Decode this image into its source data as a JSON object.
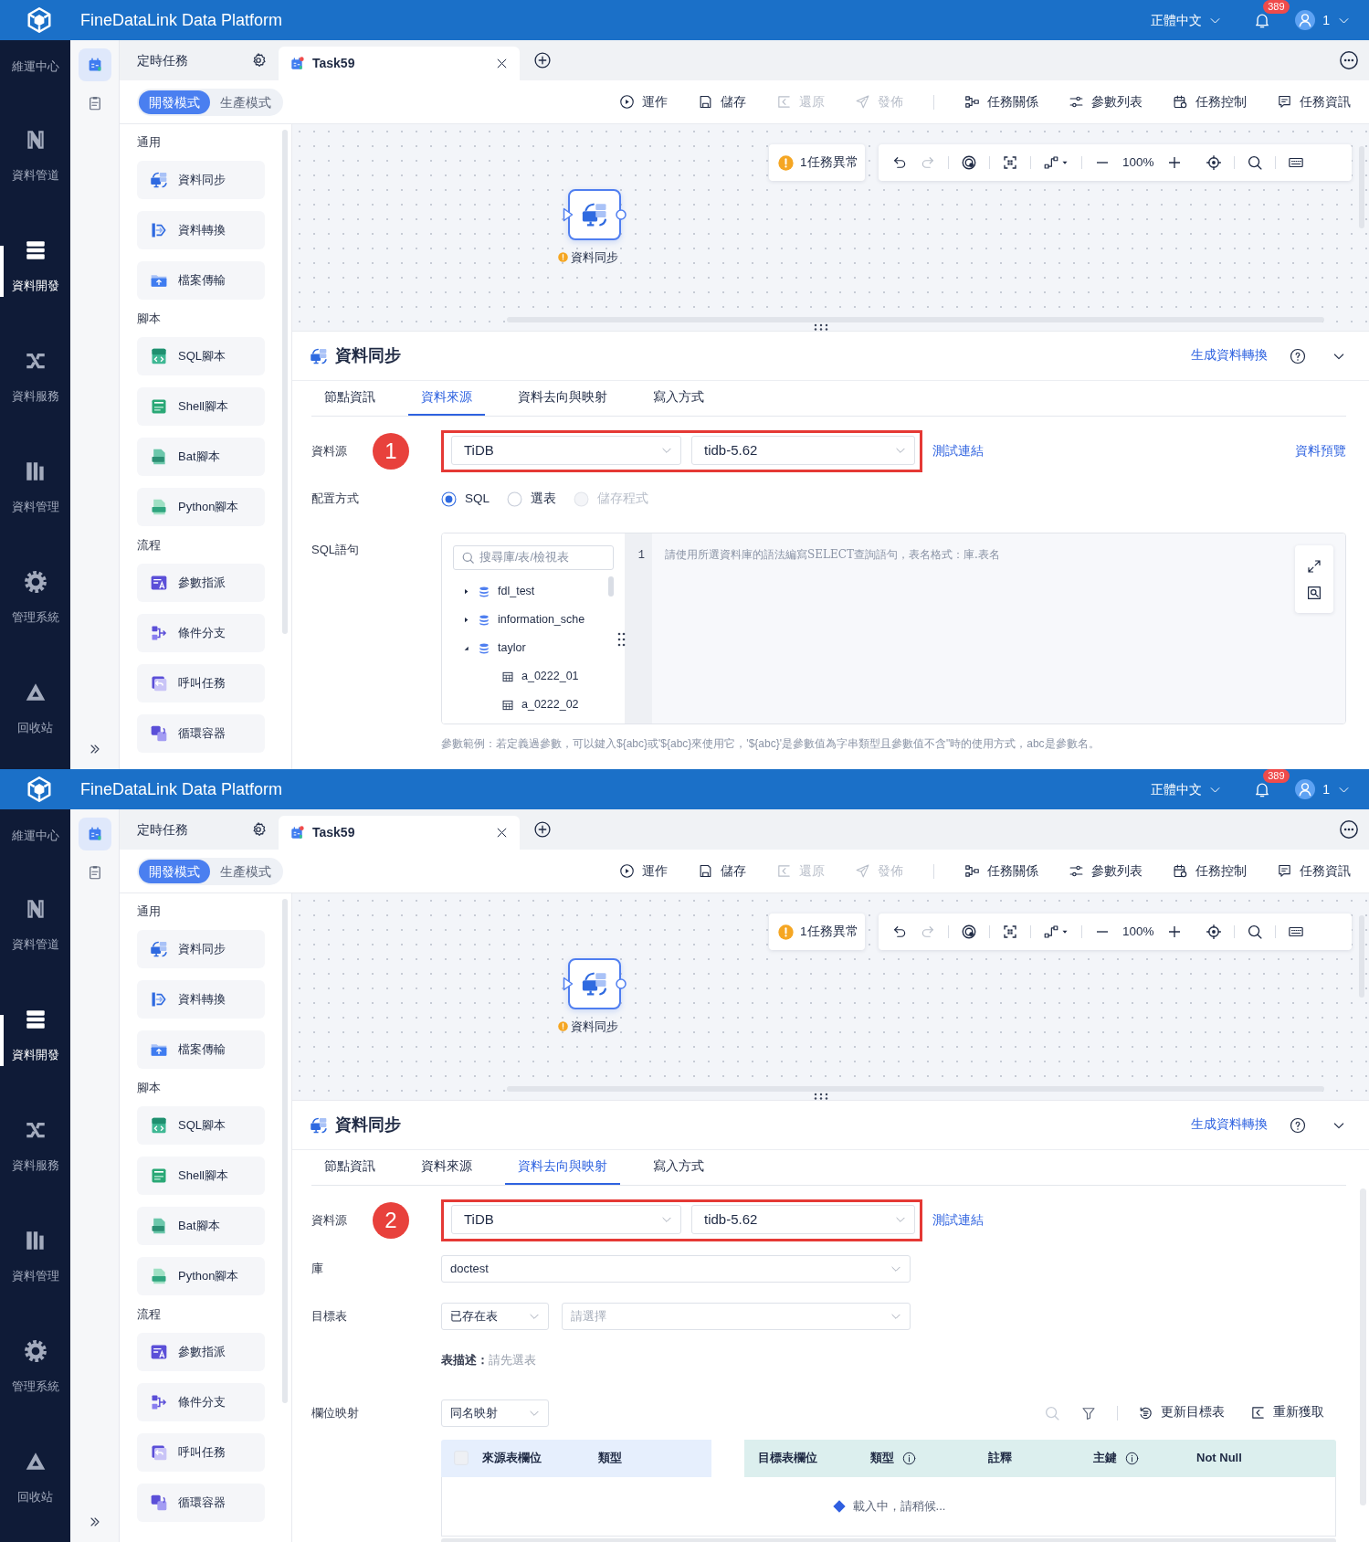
{
  "screens": [
    {
      "header": {
        "title": "FineDataLink Data Platform",
        "language": "正體中文",
        "notifications": "389",
        "user": "1"
      },
      "nav": [
        {
          "label": "維運中心",
          "selected": false
        },
        {
          "label": "資料管道",
          "selected": false
        },
        {
          "label": "資料開發",
          "selected": true
        },
        {
          "label": "資料服務",
          "selected": false
        },
        {
          "label": "資料管理",
          "selected": false
        },
        {
          "label": "管理系統",
          "selected": false
        },
        {
          "label": "回收站",
          "selected": false
        }
      ],
      "side_tabs": [
        {
          "selected": true
        },
        {
          "selected": false
        }
      ],
      "folder": {
        "label": "定時任務"
      },
      "tabs": [
        {
          "label": "Task59",
          "selected": true,
          "modified": true
        }
      ],
      "modes": [
        {
          "label": "開發模式",
          "selected": true
        },
        {
          "label": "生產模式",
          "selected": false
        }
      ],
      "toolbar": [
        {
          "items": [
            {
              "label": "運作",
              "disabled": false
            },
            {
              "label": "儲存",
              "disabled": false
            },
            {
              "label": "還原",
              "disabled": true
            },
            {
              "label": "發佈",
              "disabled": true
            }
          ]
        },
        {
          "items": [
            {
              "label": "任務關係",
              "disabled": false
            },
            {
              "label": "參數列表",
              "disabled": false
            },
            {
              "label": "任務控制",
              "disabled": false
            },
            {
              "label": "任務資訊",
              "disabled": false
            }
          ]
        }
      ],
      "palette": [
        {
          "title": "通用",
          "items": [
            {
              "label": "資料同步"
            },
            {
              "label": "資料轉換"
            },
            {
              "label": "檔案傳輸"
            }
          ]
        },
        {
          "title": "腳本",
          "items": [
            {
              "label": "SQL腳本"
            },
            {
              "label": "Shell腳本"
            },
            {
              "label": "Bat腳本"
            },
            {
              "label": "Python腳本"
            }
          ]
        },
        {
          "title": "流程",
          "items": [
            {
              "label": "參數指派"
            },
            {
              "label": "條件分支"
            },
            {
              "label": "呼叫任務"
            },
            {
              "label": "循環容器"
            }
          ]
        }
      ],
      "canvas": {
        "alert": "1任務異常",
        "history": [
          {
            "disabled": false
          },
          {
            "disabled": true
          }
        ],
        "zoom": "100%",
        "node": {
          "label": "資料同步",
          "warning": true
        }
      },
      "panel": {
        "title": "資料同步",
        "link": "生成資料轉換",
        "tabs": [
          {
            "label": "節點資訊",
            "selected": false
          },
          {
            "label": "資料來源",
            "selected": true
          },
          {
            "label": "資料去向與映射",
            "selected": false
          },
          {
            "label": "寫入方式",
            "selected": false
          }
        ],
        "rows": [
          {
            "kind": "source",
            "label": "資料源",
            "step": "1",
            "type": "TiDB",
            "connection": "tidb-5.62",
            "test_link": "測試連結",
            "preview_link": "資料預覽"
          },
          {
            "kind": "radios",
            "label": "配置方式",
            "options": [
              {
                "label": "SQL",
                "checked": true,
                "disabled": false
              },
              {
                "label": "選表",
                "checked": false,
                "disabled": false
              },
              {
                "label": "儲存程式",
                "checked": false,
                "disabled": true
              }
            ]
          },
          {
            "kind": "sql",
            "label": "SQL語句",
            "search_placeholder": "搜尋庫/表/檢視表",
            "tree": [
              {
                "label": "fdl_test",
                "expanded": false
              },
              {
                "label": "information_sche",
                "expanded": false
              },
              {
                "label": "taylor",
                "expanded": true,
                "children": [
                  {
                    "label": "a_0222_01"
                  },
                  {
                    "label": "a_0222_02"
                  }
                ]
              }
            ],
            "line_number": "1",
            "placeholder": "請使用所選資料庫的語法編寫SELECT查詢語句，表名格式：庫.表名",
            "hint": "參數範例：若定義過參數，可以鍵入${abc}或'${abc}來使用它，'${abc}'是參數值為字串類型且參數值不含\"時的使用方式，abc是參數名。"
          }
        ]
      }
    },
    {
      "header": {
        "title": "FineDataLink Data Platform",
        "language": "正體中文",
        "notifications": "389",
        "user": "1"
      },
      "nav": [
        {
          "label": "維運中心",
          "selected": false
        },
        {
          "label": "資料管道",
          "selected": false
        },
        {
          "label": "資料開發",
          "selected": true
        },
        {
          "label": "資料服務",
          "selected": false
        },
        {
          "label": "資料管理",
          "selected": false
        },
        {
          "label": "管理系統",
          "selected": false
        },
        {
          "label": "回收站",
          "selected": false
        }
      ],
      "side_tabs": [
        {
          "selected": true
        },
        {
          "selected": false
        }
      ],
      "folder": {
        "label": "定時任務"
      },
      "tabs": [
        {
          "label": "Task59",
          "selected": true,
          "modified": true
        }
      ],
      "modes": [
        {
          "label": "開發模式",
          "selected": true
        },
        {
          "label": "生產模式",
          "selected": false
        }
      ],
      "toolbar": [
        {
          "items": [
            {
              "label": "運作",
              "disabled": false
            },
            {
              "label": "儲存",
              "disabled": false
            },
            {
              "label": "還原",
              "disabled": true
            },
            {
              "label": "發佈",
              "disabled": true
            }
          ]
        },
        {
          "items": [
            {
              "label": "任務關係",
              "disabled": false
            },
            {
              "label": "參數列表",
              "disabled": false
            },
            {
              "label": "任務控制",
              "disabled": false
            },
            {
              "label": "任務資訊",
              "disabled": false
            }
          ]
        }
      ],
      "palette": [
        {
          "title": "通用",
          "items": [
            {
              "label": "資料同步"
            },
            {
              "label": "資料轉換"
            },
            {
              "label": "檔案傳輸"
            }
          ]
        },
        {
          "title": "腳本",
          "items": [
            {
              "label": "SQL腳本"
            },
            {
              "label": "Shell腳本"
            },
            {
              "label": "Bat腳本"
            },
            {
              "label": "Python腳本"
            }
          ]
        },
        {
          "title": "流程",
          "items": [
            {
              "label": "參數指派"
            },
            {
              "label": "條件分支"
            },
            {
              "label": "呼叫任務"
            },
            {
              "label": "循環容器"
            }
          ]
        }
      ],
      "canvas": {
        "alert": "1任務異常",
        "history": [
          {
            "disabled": false
          },
          {
            "disabled": true
          }
        ],
        "zoom": "100%",
        "node": {
          "label": "資料同步",
          "warning": true
        }
      },
      "panel": {
        "title": "資料同步",
        "link": "生成資料轉換",
        "scrollable": true,
        "tabs": [
          {
            "label": "節點資訊",
            "selected": false
          },
          {
            "label": "資料來源",
            "selected": false
          },
          {
            "label": "資料去向與映射",
            "selected": true
          },
          {
            "label": "寫入方式",
            "selected": false
          }
        ],
        "rows": [
          {
            "kind": "source",
            "label": "資料源",
            "step": "2",
            "type": "TiDB",
            "connection": "tidb-5.62",
            "test_link": "測試連結"
          },
          {
            "kind": "select",
            "label": "庫",
            "value": "doctest"
          },
          {
            "kind": "target",
            "label": "目標表",
            "mode": "已存在表",
            "placeholder": "請選擇",
            "note_label": "表描述：",
            "note_value": "請先選表"
          },
          {
            "kind": "mapping",
            "label": "欄位映射",
            "value": "同名映射",
            "icon_tools": [
              {
                "disabled": true
              },
              {
                "disabled": false
              }
            ],
            "actions": [
              {
                "label": "更新目標表"
              },
              {
                "label": "重新獲取"
              }
            ],
            "select_all": {
              "checked": false
            },
            "source_columns": [
              {
                "label": "來源表欄位",
                "info": false
              },
              {
                "label": "類型",
                "info": false
              }
            ],
            "target_columns": [
              {
                "label": "目標表欄位",
                "info": false
              },
              {
                "label": "類型",
                "info": true
              },
              {
                "label": "註釋",
                "info": false
              },
              {
                "label": "主鍵",
                "info": true
              },
              {
                "label": "Not Null",
                "info": false
              }
            ],
            "loading": "載入中，請稍候..."
          }
        ]
      }
    }
  ]
}
